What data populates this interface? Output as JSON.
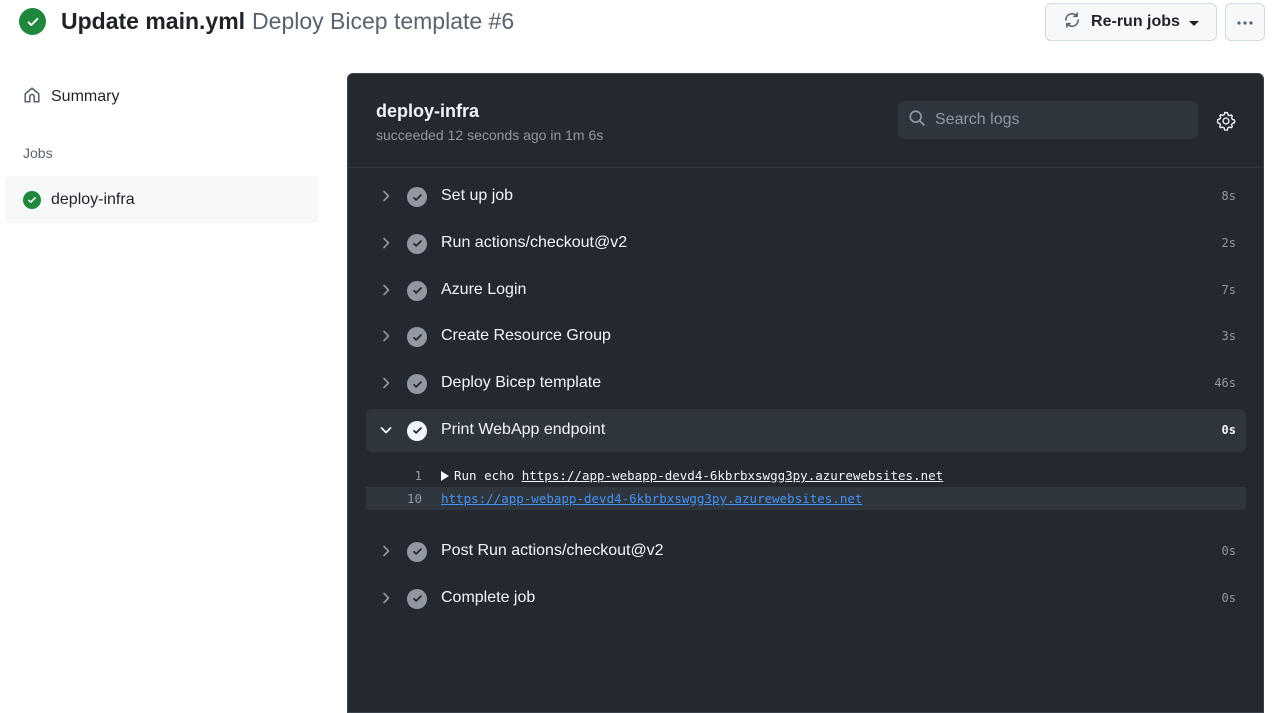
{
  "header": {
    "commit_title": "Update main.yml",
    "workflow_run": "Deploy Bicep template #6",
    "status": "success",
    "rerun_label": "Re-run jobs",
    "more_label": "More options"
  },
  "sidebar": {
    "summary_label": "Summary",
    "jobs_heading": "Jobs",
    "jobs": [
      {
        "label": "deploy-infra",
        "status": "success"
      }
    ]
  },
  "job": {
    "title": "deploy-infra",
    "meta": "succeeded 12 seconds ago in 1m 6s",
    "search_placeholder": "Search logs",
    "search_value": "",
    "steps": [
      {
        "name": "Set up job",
        "duration": "8s",
        "expanded": false
      },
      {
        "name": "Run actions/checkout@v2",
        "duration": "2s",
        "expanded": false
      },
      {
        "name": "Azure Login",
        "duration": "7s",
        "expanded": false
      },
      {
        "name": "Create Resource Group",
        "duration": "3s",
        "expanded": false
      },
      {
        "name": "Deploy Bicep template",
        "duration": "46s",
        "expanded": false
      },
      {
        "name": "Print WebApp endpoint",
        "duration": "0s",
        "expanded": true,
        "log": [
          {
            "line": "1",
            "prefix": "Run echo ",
            "link": "https://app-webapp-devd4-6kbrbxswgg3py.azurewebsites.net",
            "collapsible": true
          },
          {
            "line": "10",
            "prefix": "",
            "link": "https://app-webapp-devd4-6kbrbxswgg3py.azurewebsites.net",
            "collapsible": false
          }
        ]
      },
      {
        "name": "Post Run actions/checkout@v2",
        "duration": "0s",
        "expanded": false
      },
      {
        "name": "Complete job",
        "duration": "0s",
        "expanded": false
      }
    ]
  },
  "colors": {
    "success": "#1f883d",
    "panel_bg": "#24292f",
    "link_blue": "#4493f8"
  }
}
